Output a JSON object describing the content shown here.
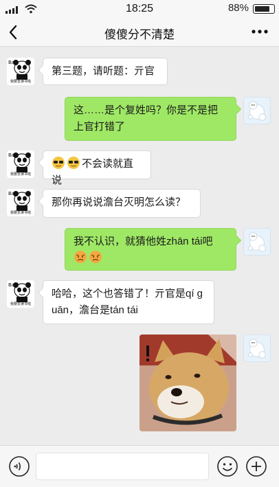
{
  "status_bar": {
    "time": "18:25",
    "battery_text": "88%",
    "battery_level": 0.88
  },
  "header": {
    "title": "傻傻分不清楚",
    "back_icon": "chevron-left-icon",
    "more_icon": "more-dots-icon"
  },
  "avatars": {
    "left_stamp": "我要去读书啦"
  },
  "messages": [
    {
      "side": "left",
      "text": "第三题，请听题：亓官"
    },
    {
      "side": "right",
      "text": "这……是个复姓吗？你是不是把上官打错了"
    },
    {
      "side": "left",
      "emoji": [
        "sunglasses-emoji",
        "sunglasses-emoji"
      ],
      "text": "不会读就直说"
    },
    {
      "side": "left",
      "text": "那你再说说澹台灭明怎么读？"
    },
    {
      "side": "right",
      "text": "我不认识，就猜他姓zhān tái吧",
      "emoji_after": [
        "worried-emoji",
        "worried-emoji"
      ]
    },
    {
      "side": "left",
      "text": "哈哈，这个也答错了！亓官是qí guān，澹台是tán tái"
    },
    {
      "side": "right",
      "image": "shiba-dog-photo"
    }
  ],
  "input_bar": {
    "voice_icon": "voice-icon",
    "input_value": "",
    "emoji_icon": "emoji-icon",
    "plus_icon": "plus-icon"
  },
  "colors": {
    "right_bubble": "#9fe865",
    "left_bubble": "#ffffff",
    "background": "#ececec"
  }
}
